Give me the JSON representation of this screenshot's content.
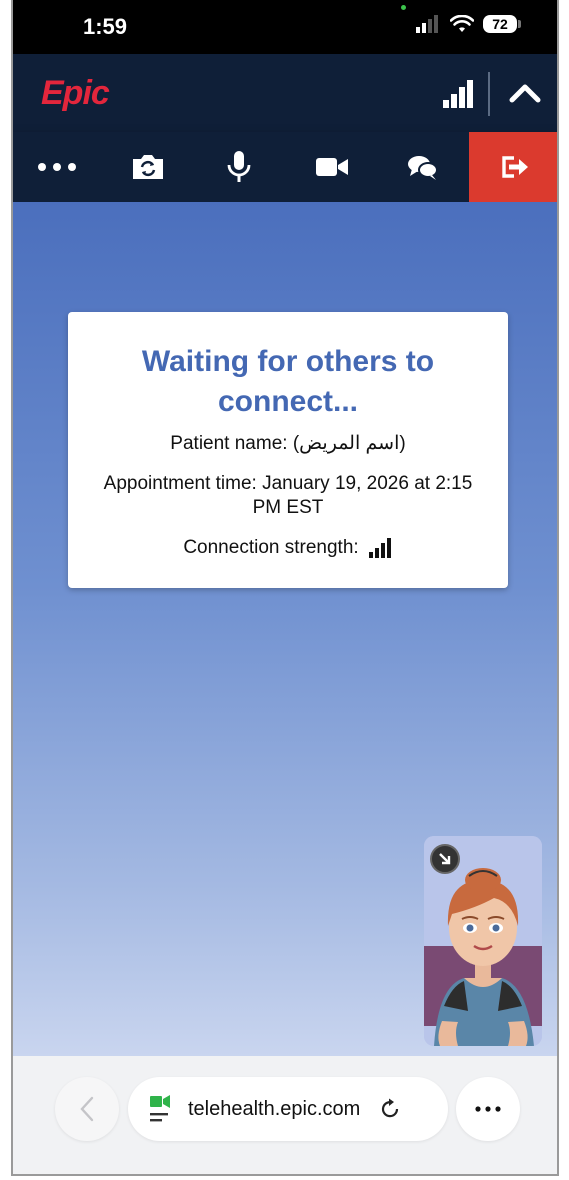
{
  "status_bar": {
    "time": "1:59",
    "battery": "72"
  },
  "app": {
    "logo_text": "Epic",
    "brand_color": "#e3263c",
    "header_color": "#0f1f38",
    "leave_color": "#db3a2e"
  },
  "toolbar": {
    "items": [
      {
        "name": "more",
        "icon": "ellipsis-icon"
      },
      {
        "name": "switch-camera",
        "icon": "camera-switch-icon"
      },
      {
        "name": "microphone",
        "icon": "microphone-icon"
      },
      {
        "name": "video",
        "icon": "video-camera-icon"
      },
      {
        "name": "chat",
        "icon": "chat-bubbles-icon"
      },
      {
        "name": "leave",
        "icon": "exit-icon"
      }
    ]
  },
  "waiting_card": {
    "title": "Waiting for others to connect...",
    "patient_line": "Patient name: (اسم المريض)",
    "appointment_line": "Appointment time: January 19, 2026 at 2:15 PM EST",
    "connection_label": "Connection strength:"
  },
  "browser": {
    "url": "telehealth.epic.com"
  }
}
